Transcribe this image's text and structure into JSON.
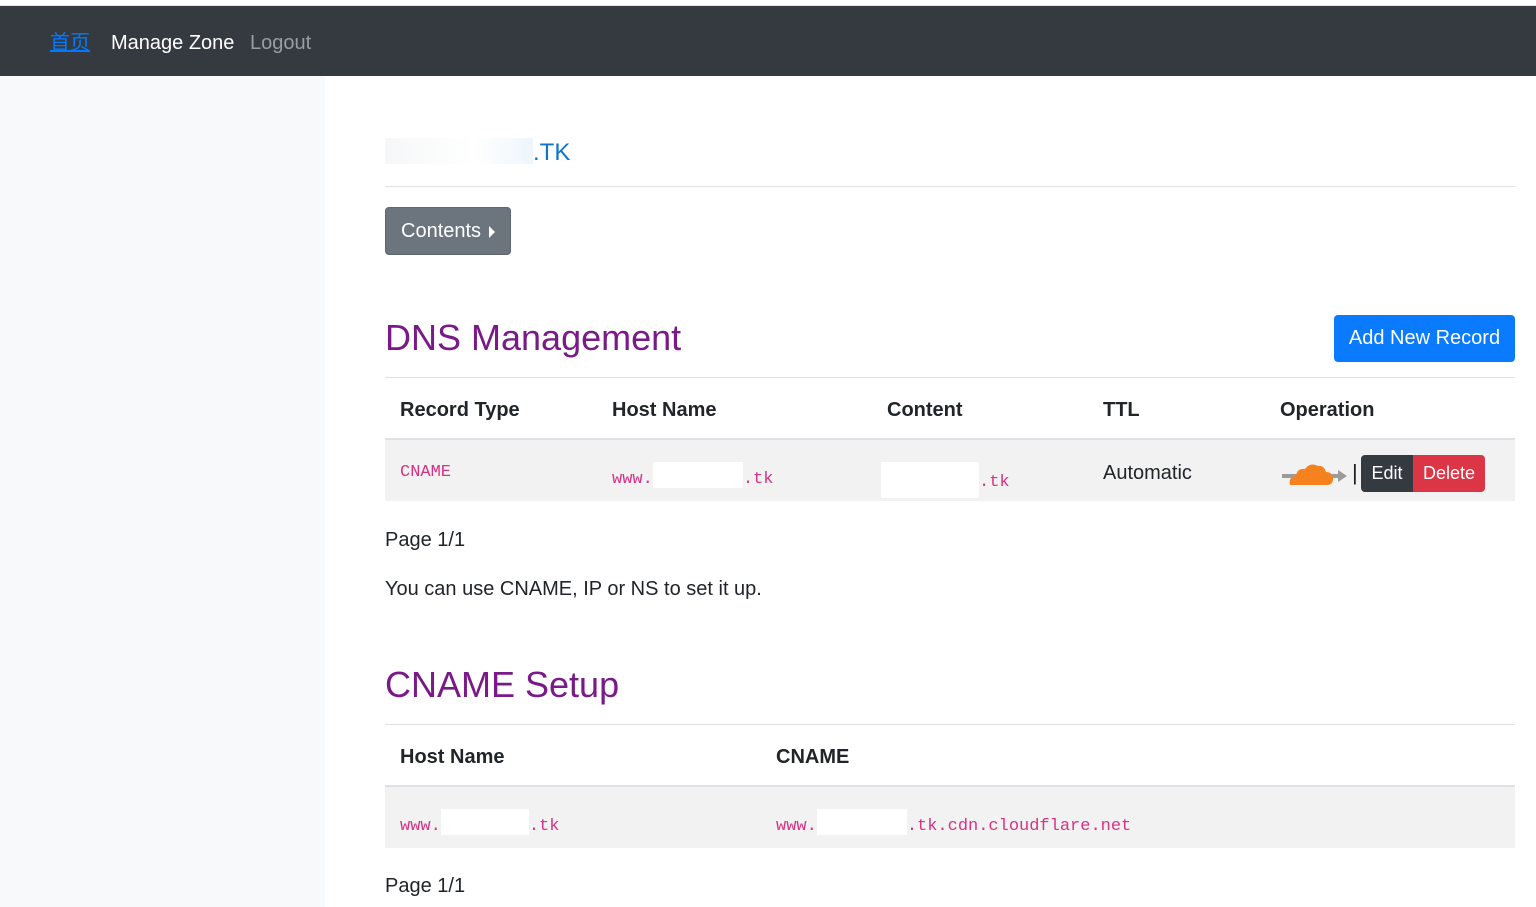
{
  "nav": {
    "home": "首页",
    "manage_zone": "Manage Zone",
    "logout": "Logout"
  },
  "zone": {
    "suffix": ".TK"
  },
  "contents_button": "Contents",
  "dns": {
    "title": "DNS Management",
    "add_button": "Add New Record",
    "columns": [
      "Record Type",
      "Host Name",
      "Content",
      "TTL",
      "Operation"
    ],
    "rows": [
      {
        "record_type": "CNAME",
        "host_prefix": "www.",
        "host_suffix": ".tk",
        "content_suffix": ".tk",
        "ttl": "Automatic",
        "edit": "Edit",
        "delete": "Delete"
      }
    ],
    "pagination": "Page 1/1",
    "note": "You can use CNAME, IP or NS to set it up."
  },
  "cname": {
    "title": "CNAME Setup",
    "columns": [
      "Host Name",
      "CNAME"
    ],
    "rows": [
      {
        "host_prefix": "www.",
        "host_suffix": ".tk",
        "cname_prefix": "www.",
        "cname_suffix": ".tk.cdn.cloudflare.net"
      }
    ],
    "pagination": "Page 1/1"
  },
  "colors": {
    "navbar": "#343a40",
    "heading": "#7a1a88",
    "primary": "#0a7bff",
    "danger": "#dc3545",
    "code": "#d63384",
    "cloud": "#f6821f"
  }
}
